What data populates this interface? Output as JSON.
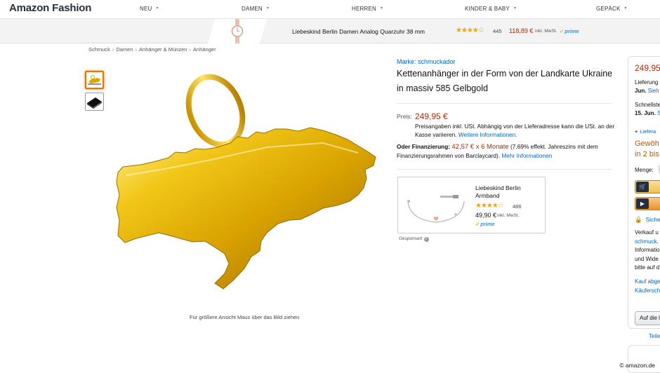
{
  "brand_logo": "Amazon Fashion",
  "nav": {
    "items": [
      {
        "label": "NEU"
      },
      {
        "label": "DAMEN"
      },
      {
        "label": "HERREN"
      },
      {
        "label": "KINDER & BABY"
      },
      {
        "label": "GEPÄCK"
      }
    ]
  },
  "promo": {
    "title": "Liebeskind Berlin Damen Analog Quarzuhr 38 mm",
    "stars": "★★★★☆",
    "rating": 4.5,
    "review_count": "445",
    "price": "118,89 €",
    "tax": "inkl. MwSt.",
    "prime": "prime"
  },
  "breadcrumb": [
    "Schmuck",
    "Damen",
    "Anhänger & Münzen",
    "Anhänger"
  ],
  "image_hint": "Für größere Ansicht Maus über das Bild ziehen",
  "product": {
    "brand_link": "Marke: schmuckador",
    "title": "Kettenanhänger in der Form von der Landkarte Ukraine in massiv 585 Gelbgold",
    "price_label": "Preis:",
    "price": "249,95 €",
    "tax_note": "Preisangaben inkl. USt. Abhängig von der Lieferadresse kann die USt. an der Kasse variieren.",
    "tax_link": "Weitere Informationen.",
    "financing_label": "Oder Finanzierung:",
    "financing_amount": "42,57 € x 6 Monate",
    "financing_text": "(7,69% effekt. Jahreszins mit dem Finanzierungsrahmen von Barclaycard).",
    "financing_link": "Mehr Informationen"
  },
  "ad": {
    "title": "Liebeskind Berlin Armband",
    "stars": "★★★★☆",
    "rating": 4.5,
    "review_count": "486",
    "price": "49,90 €",
    "tax": "inkl. MwSt.",
    "prime": "prime",
    "sponsored_label": "Gesponsert"
  },
  "buybox": {
    "price": "249,95",
    "delivery_line1": "Lieferung",
    "delivery_line2_bold": "Jun.",
    "delivery_line2_link": "Sieh",
    "fastest_line1": "Schnellste",
    "fastest_line2_bold": "15. Jun.",
    "fastest_line2_link": "S",
    "deliver_to": "Liefera",
    "availability_line1": "Gewöh",
    "availability_line2": "in 2 bis",
    "qty_label": "Menge:",
    "secure": "Sicher",
    "sold_lines": [
      "Verkauf u",
      "schmuck.",
      "Informatio",
      "und Wide",
      "bitte auf d"
    ],
    "faq_lines": [
      "Kauf abge",
      "Käufersch"
    ],
    "wishlist": "Auf die l",
    "share": "Teile"
  },
  "colors": {
    "price": "#b12704",
    "link": "#0066c0",
    "gold": "#e6b800",
    "star": "#f0a30a",
    "availability": "#c45500"
  },
  "watermark": "© amazon.de"
}
